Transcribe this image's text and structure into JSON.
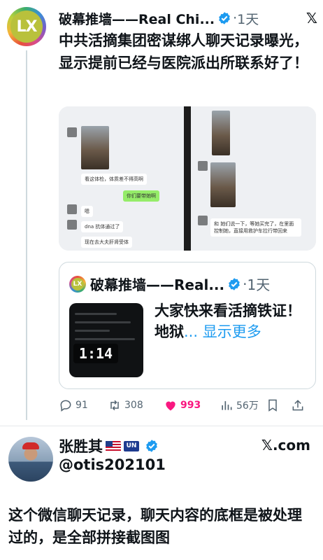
{
  "post": {
    "avatar_text": "LX",
    "name": "破幕推墙——Real Chi...",
    "dot": "·",
    "time": "1天",
    "body": "中共活摘集团密谋绑人聊天记录曝光，显示提前已经与医院派出所联系好了！",
    "media": {
      "left_messages": [
        "看这体检，体质差不得高啊",
        "你们要带她啊",
        "嗯",
        "dna 抗体通过了",
        "现在去大夫肝肾受体"
      ],
      "right_messages": [
        "和  她们说一下，等她买完了，在里面控制她，直接用救护车拉行带回来"
      ]
    },
    "quote": {
      "avatar_text": "LX",
      "name": "破幕推墙——Real...",
      "dot": "·",
      "time": "1天",
      "text": "大家快来看活摘铁证！地狱",
      "show_more": "... 显示更多",
      "video_duration": "1:14"
    },
    "actions": {
      "replies": "91",
      "retweets": "308",
      "likes": "993",
      "views": "56万"
    }
  },
  "reply": {
    "name": "张胜其",
    "handle": "@otis202101",
    "source": "𝕏.com",
    "un_flag_text": "UN",
    "text": "这个微信聊天记录，聊天内容的底框是被处理过的，是全部拼接截图图"
  },
  "colors": {
    "accent": "#1d9bf0",
    "like": "#f91880",
    "text": "#0f1419",
    "muted": "#536471"
  },
  "icons": [
    "verified-badge-icon",
    "x-logo-icon",
    "reply-icon",
    "retweet-icon",
    "like-icon",
    "views-icon",
    "bookmark-icon",
    "share-icon"
  ]
}
